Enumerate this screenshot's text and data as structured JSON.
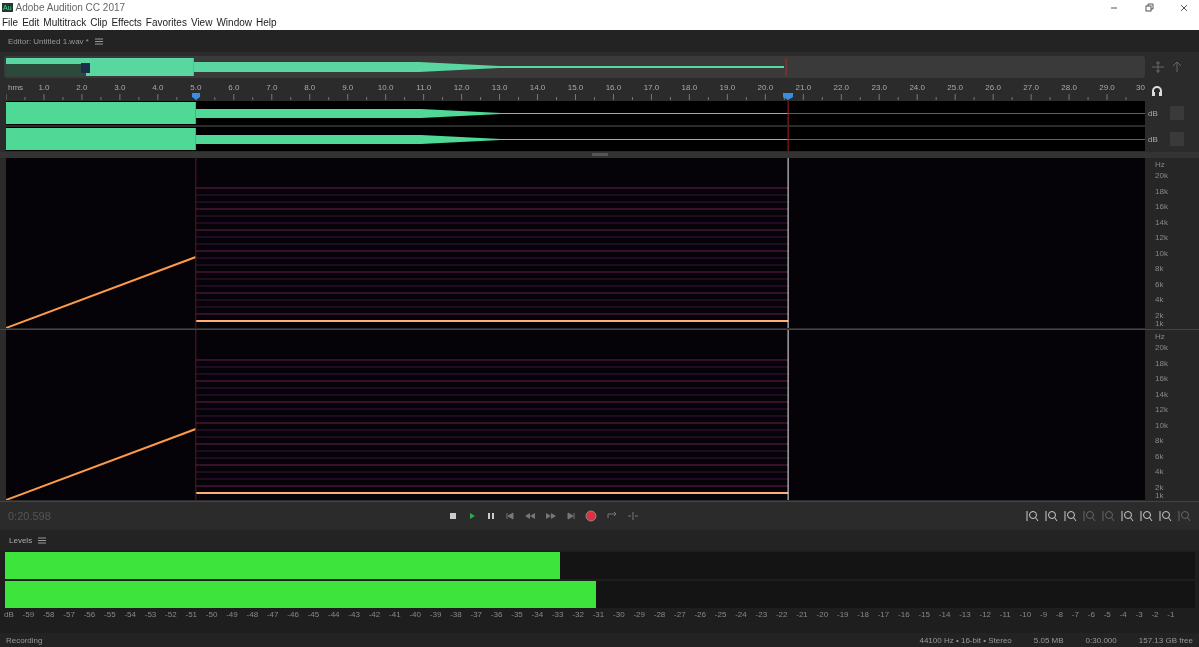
{
  "window": {
    "title": "Adobe Audition CC 2017",
    "app_badge": "Au"
  },
  "menu": [
    "File",
    "Edit",
    "Multitrack",
    "Clip",
    "Effects",
    "Favorites",
    "View",
    "Window",
    "Help"
  ],
  "editor": {
    "tab": "Editor: Untitled 1.wav *"
  },
  "ruler": {
    "unit": "hms",
    "ticks": [
      "1.0",
      "2.0",
      "3.0",
      "4.0",
      "5.0",
      "6.0",
      "7.0",
      "8.0",
      "9.0",
      "10.0",
      "11.0",
      "12.0",
      "13.0",
      "14.0",
      "15.0",
      "16.0",
      "17.0",
      "18.0",
      "19.0",
      "20.0",
      "21.0",
      "22.0",
      "23.0",
      "24.0",
      "25.0",
      "26.0",
      "27.0",
      "28.0",
      "29.0",
      "30"
    ]
  },
  "waveform_channels": [
    {
      "unit": "dB"
    },
    {
      "unit": "dB"
    }
  ],
  "spectral_channels": [
    {
      "unit": "Hz",
      "labels": [
        "20k",
        "18k",
        "16k",
        "14k",
        "12k",
        "10k",
        "8k",
        "6k",
        "4k",
        "2k",
        "1k"
      ]
    },
    {
      "unit": "Hz",
      "labels": [
        "20k",
        "18k",
        "16k",
        "14k",
        "12k",
        "10k",
        "8k",
        "6k",
        "4k",
        "2k",
        "1k"
      ]
    }
  ],
  "transport": {
    "time": "0:20.598"
  },
  "levels": {
    "title": "Levels",
    "meters": [
      {
        "level": 0.466
      },
      {
        "level": 0.497
      }
    ],
    "scale": [
      "dB",
      "-59",
      "-58",
      "-57",
      "-56",
      "-55",
      "-54",
      "-53",
      "-52",
      "-51",
      "-50",
      "-49",
      "-48",
      "-47",
      "-46",
      "-45",
      "-44",
      "-43",
      "-42",
      "-41",
      "-40",
      "-39",
      "-38",
      "-37",
      "-36",
      "-35",
      "-34",
      "-33",
      "-32",
      "-31",
      "-30",
      "-29",
      "-28",
      "-27",
      "-26",
      "-25",
      "-24",
      "-23",
      "-22",
      "-21",
      "-20",
      "-19",
      "-18",
      "-17",
      "-16",
      "-15",
      "-14",
      "-13",
      "-12",
      "-11",
      "-10",
      "-9",
      "-8",
      "-7",
      "-6",
      "-5",
      "-4",
      "-3",
      "-2",
      "-1"
    ]
  },
  "status_bar": {
    "left": "Recording",
    "items": [
      "44100 Hz • 16-bit • Stereo",
      "5.05 MB",
      "0:30.000",
      "157.13 GB free"
    ]
  }
}
